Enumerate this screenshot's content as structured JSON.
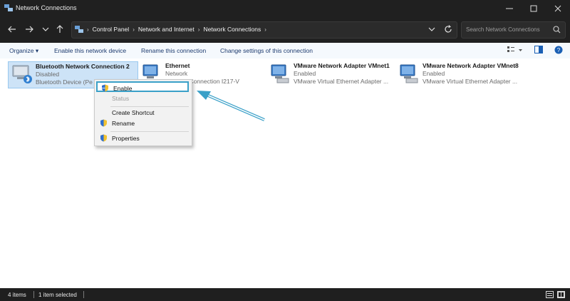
{
  "window": {
    "title": "Network Connections"
  },
  "breadcrumb": [
    "Control Panel",
    "Network and Internet",
    "Network Connections"
  ],
  "search": {
    "placeholder": "Search Network Connections"
  },
  "toolbar": {
    "organize": "Organize",
    "enable_device": "Enable this network device",
    "rename": "Rename this connection",
    "change_settings": "Change settings of this connection"
  },
  "connections": [
    {
      "name": "Bluetooth Network Connection 2",
      "status": "Disabled",
      "device": "Bluetooth Device (Pe"
    },
    {
      "name": "Ethernet",
      "status": "Network",
      "device": "ethernet Connection I217-V"
    },
    {
      "name": "VMware Network Adapter VMnet1",
      "status": "Enabled",
      "device": "VMware Virtual Ethernet Adapter ..."
    },
    {
      "name": "VMware Network Adapter VMnet8",
      "status": "Enabled",
      "device": "VMware Virtual Ethernet Adapter ..."
    }
  ],
  "context_menu": {
    "enable": "Enable",
    "status": "Status",
    "create_shortcut": "Create Shortcut",
    "rename": "Rename",
    "properties": "Properties"
  },
  "statusbar": {
    "count": "4 items",
    "selected": "1 item selected"
  },
  "colors": {
    "highlight": "#3aa0c8",
    "selection": "#cde3f7",
    "link": "#1c3a6e"
  }
}
